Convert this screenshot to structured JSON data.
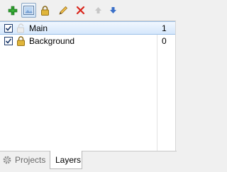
{
  "toolbar": {
    "buttons": [
      {
        "name": "add-layer",
        "icon": "plus-icon"
      },
      {
        "name": "layer-properties",
        "icon": "image-icon"
      },
      {
        "name": "lock-layer",
        "icon": "lock-icon"
      },
      {
        "name": "edit-layer",
        "icon": "pencil-icon"
      },
      {
        "name": "delete-layer",
        "icon": "close-icon"
      },
      {
        "name": "move-layer-up",
        "icon": "arrow-up-icon"
      },
      {
        "name": "move-layer-down",
        "icon": "arrow-down-icon"
      }
    ]
  },
  "layers": [
    {
      "name": "Main",
      "index": "1",
      "visible": true,
      "locked": false,
      "selected": true
    },
    {
      "name": "Background",
      "index": "0",
      "visible": true,
      "locked": true,
      "selected": false
    }
  ],
  "tabs": {
    "projects_label": "Projects",
    "layers_label": "Layers",
    "active": "Layers"
  },
  "colors": {
    "selection": "#d5e7fb",
    "add": "#2e9e2e",
    "delete": "#d9261c",
    "arrow": "#3a6fc8"
  }
}
